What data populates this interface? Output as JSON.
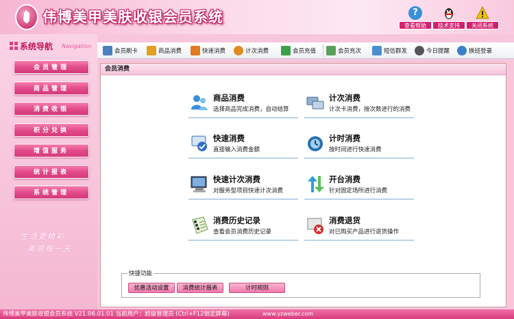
{
  "header": {
    "app_title": "伟博美甲美肤收银会员系统",
    "buttons": [
      {
        "label": "查看帮助",
        "icon": "help-icon",
        "color": "#3a8fd9"
      },
      {
        "label": "技术支持",
        "icon": "qq-penguin-icon",
        "color": "#222222"
      },
      {
        "label": "关闭系统",
        "icon": "warning-icon",
        "color": "#f2c200"
      }
    ]
  },
  "sidebar": {
    "title": "系统导航",
    "title_en": "Navigation",
    "items": [
      {
        "label": "会员管理"
      },
      {
        "label": "商品管理"
      },
      {
        "label": "消费收银"
      },
      {
        "label": "积分兑换"
      },
      {
        "label": "增值服务"
      },
      {
        "label": "统计报表"
      },
      {
        "label": "系统管理"
      }
    ],
    "slogan": [
      "生活更精彩",
      "美丽每一天"
    ]
  },
  "toolbar": {
    "items": [
      {
        "label": "会员刷卡",
        "icon": "card-swipe-icon",
        "color": "#4a7fc1"
      },
      {
        "label": "商品消费",
        "icon": "shopping-bag-icon",
        "color": "#e0a020"
      },
      {
        "label": "快速消费",
        "icon": "fast-consume-icon",
        "color": "#e07b20"
      },
      {
        "label": "计次消费",
        "icon": "refresh-icon",
        "color": "#e08a20"
      },
      {
        "label": "会员充值",
        "icon": "recharge-icon",
        "color": "#3aa04a"
      },
      {
        "label": "会员充次",
        "icon": "recharge-count-icon",
        "color": "#5aa05a"
      },
      {
        "label": "短信群发",
        "icon": "sms-icon",
        "color": "#4a90d0"
      },
      {
        "label": "今日提醒",
        "icon": "clock-icon",
        "color": "#555555"
      },
      {
        "label": "换班登录",
        "icon": "login-switch-icon",
        "color": "#3a7fc9"
      }
    ]
  },
  "panel": {
    "title": "会员消费",
    "functions": [
      {
        "title": "商品消费",
        "desc": "选择商品完成消费，自动结算",
        "icon": "users-icon",
        "color": "#3a8fd9"
      },
      {
        "title": "计次消费",
        "desc": "计次卡消费，按次数进行的消费",
        "icon": "count-card-icon",
        "color": "#6a8fb0"
      },
      {
        "title": "快速消费",
        "desc": "直接输入消费金额",
        "icon": "check-card-icon",
        "color": "#2f6fc4"
      },
      {
        "title": "计时消费",
        "desc": "按时间进行快速消费",
        "icon": "timer-icon",
        "color": "#2a6fb0"
      },
      {
        "title": "快速计次消费",
        "desc": "对服务型项目快速计次消费",
        "icon": "monitor-icon",
        "color": "#3a5f8a"
      },
      {
        "title": "开台消费",
        "desc": "针对固定场所进行消费",
        "icon": "arrows-icon",
        "color": "#2f9fd9"
      },
      {
        "title": "消费历史记录",
        "desc": "查看会员消费历史记录",
        "icon": "notebook-icon",
        "color": "#6aa04a"
      },
      {
        "title": "消费退货",
        "desc": "对已购买产品进行退货操作",
        "icon": "return-icon",
        "color": "#c04040"
      }
    ],
    "quick": {
      "legend": "快捷功能",
      "buttons": [
        {
          "label": "优惠活动设置"
        },
        {
          "label": "消费统计报表"
        },
        {
          "label": "计时规则"
        }
      ]
    }
  },
  "statusbar": {
    "text": "伟博美甲美肤收银会员系统 V21.06.01.01 当前用户：超级管理员 (Ctrl+F12锁定屏幕)",
    "url": "www.yzweber.com"
  }
}
